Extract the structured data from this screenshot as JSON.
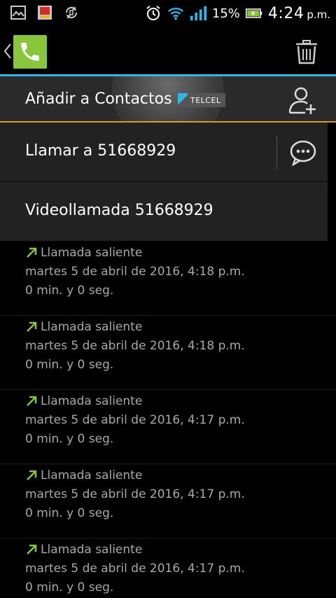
{
  "status_bar": {
    "battery": "15%",
    "time": "4:24",
    "ampm": "p.m."
  },
  "action_bar": {
    "app_icon": "phone-icon",
    "delete_icon": "trash-icon"
  },
  "contact_header": {
    "add_label": "Añadir a Contactos",
    "carrier": "TELCEL"
  },
  "actions": {
    "call_label": "Llamar a 51668929",
    "video_label": "Videollamada 51668929"
  },
  "call_log": [
    {
      "type": "Llamada saliente",
      "date": "martes 5 de abril de 2016, 4:18 p.m.",
      "duration": "0 min. y 0 seg."
    },
    {
      "type": "Llamada saliente",
      "date": "martes 5 de abril de 2016, 4:18 p.m.",
      "duration": "0 min. y 0 seg."
    },
    {
      "type": "Llamada saliente",
      "date": "martes 5 de abril de 2016, 4:17 p.m.",
      "duration": "0 min. y 0 seg."
    },
    {
      "type": "Llamada saliente",
      "date": "martes 5 de abril de 2016, 4:17 p.m.",
      "duration": "0 min. y 0 seg."
    },
    {
      "type": "Llamada saliente",
      "date": "martes 5 de abril de 2016, 4:17 p.m.",
      "duration": "0 min. y 0 seg."
    }
  ],
  "colors": {
    "accent_blue": "#33b5e5",
    "accent_orange": "#d89c2a",
    "outgoing_arrow": "#8ac53e",
    "app_green": "#8ac53e"
  }
}
